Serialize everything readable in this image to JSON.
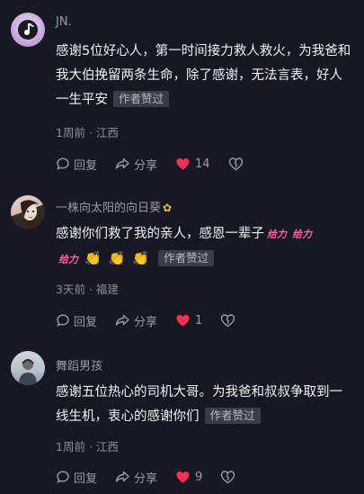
{
  "comments": [
    {
      "name": "JN.",
      "text": "感谢5位好心人，第一时间接力救人救火，为我爸和我大伯挽留两条生命，除了感谢，无法言表，好人一生平安",
      "tag": "作者赞过",
      "meta": "1周前 · 江西",
      "reply": "回复",
      "share": "分享",
      "likes": "14",
      "avatar_icon": "tiktok-note-icon"
    },
    {
      "name": "一株向太阳的向日葵",
      "name_emoji": "✿",
      "text": "感谢你们救了我的亲人，感恩一辈子",
      "stickers": [
        "给力",
        "给力",
        "给力"
      ],
      "claps": [
        "👏",
        "👏",
        "👏"
      ],
      "tag": "作者赞过",
      "meta": "3天前 · 福建",
      "reply": "回复",
      "share": "分享",
      "likes": "1",
      "avatar_icon": "portrait-icon"
    },
    {
      "name": "舞蹈男孩",
      "text": "感谢五位热心的司机大哥。为我爸和叔叔争取到一线生机，衷心的感谢你们",
      "tag": "作者赞过",
      "meta": "1周前 · 江西",
      "reply": "回复",
      "share": "分享",
      "likes": "9",
      "avatar_icon": "portrait-icon"
    }
  ],
  "colors": {
    "background": "#161823",
    "like_red": "#fe2c55",
    "sticker_pink": "#ff5fa2"
  }
}
